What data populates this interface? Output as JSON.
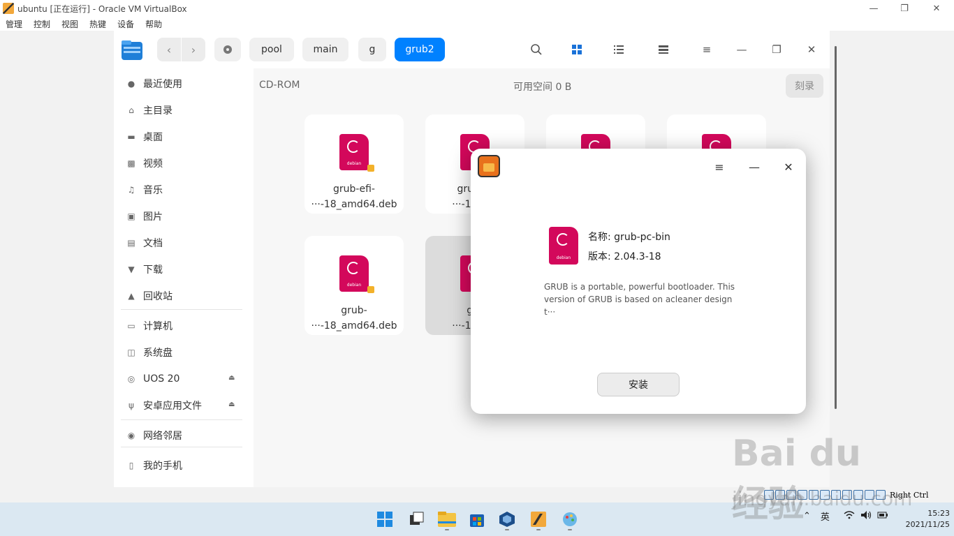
{
  "vbox": {
    "title": "ubuntu [正在运行] - Oracle VM VirtualBox",
    "menu": [
      "管理",
      "控制",
      "视图",
      "热键",
      "设备",
      "帮助"
    ],
    "status_hotkey": "Right Ctrl"
  },
  "file_manager": {
    "breadcrumbs": [
      "pool",
      "main",
      "g",
      "grub2"
    ],
    "active_crumb": "grub2",
    "sidebar": {
      "items": [
        {
          "label": "最近使用",
          "icon": "clock-icon"
        },
        {
          "label": "主目录",
          "icon": "home-icon"
        },
        {
          "label": "桌面",
          "icon": "desktop-icon"
        },
        {
          "label": "视频",
          "icon": "video-icon"
        },
        {
          "label": "音乐",
          "icon": "music-icon"
        },
        {
          "label": "图片",
          "icon": "picture-icon"
        },
        {
          "label": "文档",
          "icon": "document-icon"
        },
        {
          "label": "下载",
          "icon": "download-icon"
        },
        {
          "label": "回收站",
          "icon": "trash-icon"
        }
      ],
      "devices": [
        {
          "label": "计算机",
          "icon": "computer-icon"
        },
        {
          "label": "系统盘",
          "icon": "disk-icon"
        },
        {
          "label": "UOS 20",
          "icon": "cdrom-icon"
        },
        {
          "label": "安卓应用文件",
          "icon": "usb-icon"
        }
      ],
      "network": {
        "label": "网络邻居",
        "icon": "network-icon"
      },
      "phone": {
        "label": "我的手机",
        "icon": "phone-icon"
      }
    },
    "content": {
      "location": "CD-ROM",
      "free_space": "可用空间 0 B",
      "burn_label": "刻录",
      "files": [
        {
          "line1": "grub-efi-",
          "line2": "···-18_amd64.deb"
        },
        {
          "line1": "grub-ef",
          "line2": "···-18_am"
        },
        {
          "line1": "grub-",
          "line2": "···-18_amd64.deb"
        },
        {
          "line1": "gru",
          "line2": "···-18_am"
        }
      ]
    }
  },
  "installer": {
    "name_label": "名称:",
    "name_value": "grub-pc-bin",
    "version_label": "版本:",
    "version_value": "2.04.3-18",
    "description_line1": "GRUB is a portable, powerful bootloader.  This",
    "description_line2": "version of GRUB is based on acleaner design t···",
    "install_label": "安装",
    "icon_word": "debian"
  },
  "taskbar": {
    "ime": "英",
    "time": "15:23",
    "date": "2021/11/25"
  },
  "watermark": {
    "brand": "Bai du 经验",
    "url": "jingyan.baidu.com"
  },
  "colors": {
    "accent": "#0081ff",
    "debian": "#d3085b"
  }
}
